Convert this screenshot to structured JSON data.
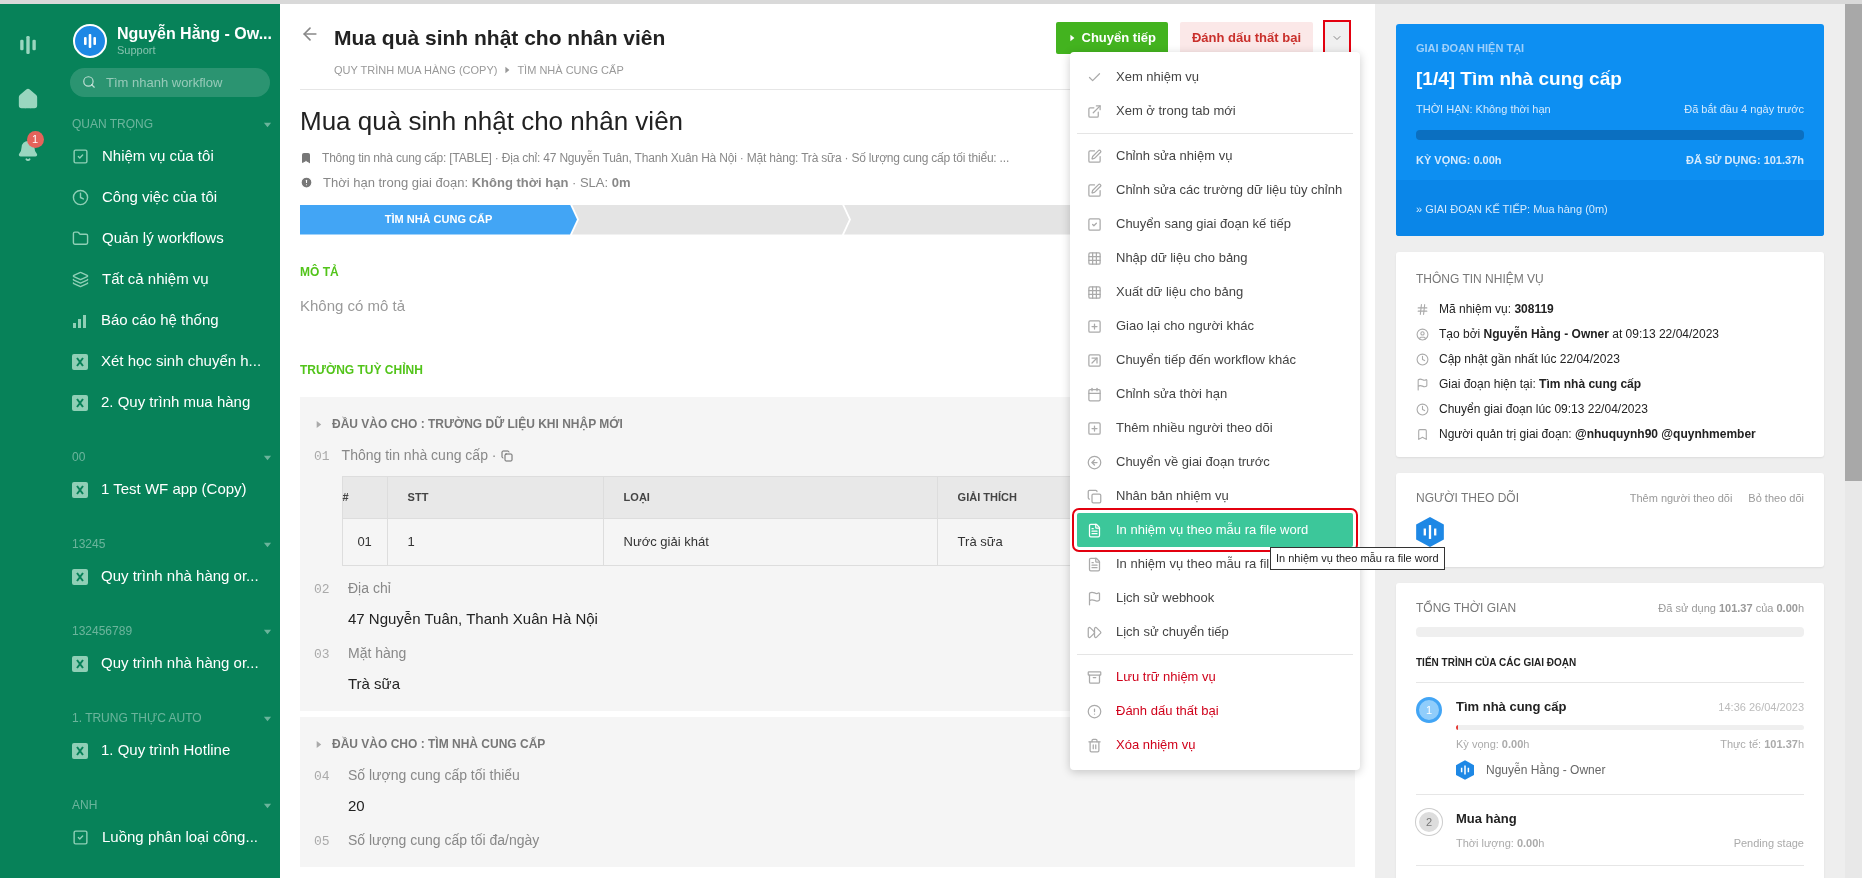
{
  "rail": {
    "notification_count": "1"
  },
  "user": {
    "name": "Nguyễn Hằng - Ow...",
    "role": "Support"
  },
  "search": {
    "placeholder": "Tìm nhanh workflow"
  },
  "sidebar_sections": [
    {
      "title": "QUAN TRỌNG",
      "items": [
        {
          "label": "Nhiệm vụ của tôi",
          "kind": "shortcut"
        },
        {
          "label": "Công việc của tôi",
          "kind": "shortcut"
        },
        {
          "label": "Quản lý workflows",
          "kind": "shortcut"
        },
        {
          "label": "Tất cả nhiệm vụ",
          "kind": "shortcut"
        },
        {
          "label": "Báo cáo hệ thống",
          "kind": "shortcut"
        },
        {
          "label": "Xét học sinh chuyển h...",
          "kind": "workflow"
        },
        {
          "label": "2. Quy trình mua hàng",
          "kind": "workflow"
        }
      ]
    },
    {
      "title": "00",
      "items": [
        {
          "label": "1 Test WF app (Copy)",
          "kind": "workflow"
        }
      ]
    },
    {
      "title": "13245",
      "items": [
        {
          "label": "Quy trình nhà hàng or...",
          "kind": "workflow"
        }
      ]
    },
    {
      "title": "132456789",
      "items": [
        {
          "label": "Quy trình nhà hàng or...",
          "kind": "workflow"
        }
      ]
    },
    {
      "title": "1. TRUNG THỰC AUTO",
      "items": [
        {
          "label": "1. Quy trình Hotline",
          "kind": "workflow"
        }
      ]
    },
    {
      "title": "ANH",
      "items": [
        {
          "label": "Luồng phân loại công...",
          "kind": "task"
        }
      ]
    }
  ],
  "header": {
    "title": "Mua quà sinh nhật cho nhân viên",
    "breadcrumb": [
      "QUY TRÌNH MUA HÀNG (COPY)",
      "TÌM NHÀ CUNG CẤP"
    ],
    "forward_button": "Chuyển tiếp",
    "fail_button": "Đánh dấu thất bại",
    "dropdown": {
      "expanded": true
    }
  },
  "task": {
    "title": "Mua quà sinh nhật cho nhân viên",
    "summary": "Thông tin nhà cung cấp: [TABLE] · Địa chỉ: 47 Nguyễn Tuân, Thanh Xuân Hà Nội · Mặt hàng: Trà sữa · Số lượng cung cấp tối thiểu: ...",
    "deadline": "Thời hạn trong giai đoạn: **Không thời hạn** · SLA: **0m**"
  },
  "stage_bar": {
    "stages": [
      {
        "label": "TÌM NHÀ CUNG CẤP",
        "selected": true
      },
      {
        "selected": false
      },
      {
        "selected": false
      }
    ]
  },
  "description": {
    "heading": "MÔ TẢ",
    "text": "Không có mô tả"
  },
  "custom_fields": {
    "heading": "TRƯỜNG TUỲ CHỈNH",
    "groups": [
      {
        "title": "ĐẦU VÀO CHO : TRƯỜNG DỮ LIỆU KHI NHẬP MỚI",
        "fields": [
          {
            "number": "01",
            "label": "Thông tin nhà cung cấp ·",
            "kind": "table",
            "table": {
              "columns": [
                "#",
                "STT",
                "LOẠI",
                "GIẢI THÍCH"
              ],
              "rows": [
                [
                  "01",
                  "1",
                  "Nước giải khát",
                  "Trà sữa"
                ]
              ]
            }
          },
          {
            "number": "02",
            "label": "Địa chỉ",
            "kind": "text",
            "value": "47 Nguyễn Tuân, Thanh Xuân Hà Nội"
          },
          {
            "number": "03",
            "label": "Mặt hàng",
            "kind": "text",
            "value": "Trà sữa"
          }
        ]
      },
      {
        "title": "ĐẦU VÀO CHO : TÌM NHÀ CUNG CẤP",
        "fields": [
          {
            "number": "04",
            "label": "Số lượng cung cấp tối thiểu",
            "kind": "text",
            "value": "20"
          },
          {
            "number": "05",
            "label": "Số lượng cung cấp tối đa/ngày",
            "kind": "text"
          }
        ]
      }
    ]
  },
  "menu": {
    "groups": [
      {
        "items": [
          {
            "label": "Xem nhiệm vụ",
            "danger": false,
            "selected": false
          },
          {
            "label": "Xem ở trong tab mới",
            "danger": false,
            "selected": false
          }
        ]
      },
      {
        "items": [
          {
            "label": "Chỉnh sửa nhiệm vụ",
            "danger": false,
            "selected": false
          },
          {
            "label": "Chỉnh sửa các trường dữ liệu tùy chỉnh",
            "danger": false,
            "selected": false
          },
          {
            "label": "Chuyển sang giai đoạn kế tiếp",
            "danger": false,
            "selected": false
          },
          {
            "label": "Nhập dữ liệu cho bảng",
            "danger": false,
            "selected": false
          },
          {
            "label": "Xuất dữ liệu cho bảng",
            "danger": false,
            "selected": false
          },
          {
            "label": "Giao lại cho người khác",
            "danger": false,
            "selected": false
          },
          {
            "label": "Chuyển tiếp đến workflow khác",
            "danger": false,
            "selected": false
          },
          {
            "label": "Chỉnh sửa thời hạn",
            "danger": false,
            "selected": false
          },
          {
            "label": "Thêm nhiều người theo dõi",
            "danger": false,
            "selected": false
          },
          {
            "label": "Chuyển về giai đoạn trước",
            "danger": false,
            "selected": false
          },
          {
            "label": "Nhân bản nhiệm vụ",
            "danger": false,
            "selected": false
          },
          {
            "label": "In nhiệm vụ theo mẫu ra file word",
            "danger": false,
            "selected": true
          },
          {
            "label": "In nhiệm vụ theo mẫu ra fil",
            "danger": false,
            "selected": false
          },
          {
            "label": "Lịch sử webhook",
            "danger": false,
            "selected": false
          },
          {
            "label": "Lịch sử chuyển tiếp",
            "danger": false,
            "selected": false
          }
        ]
      },
      {
        "items": [
          {
            "label": "Lưu trữ nhiệm vụ",
            "danger": true,
            "selected": false
          },
          {
            "label": "Đánh dấu thất bại",
            "danger": true,
            "selected": false
          },
          {
            "label": "Xóa nhiệm vụ",
            "danger": true,
            "selected": false
          }
        ]
      }
    ]
  },
  "tooltip": "In nhiệm vụ theo mẫu ra file word",
  "current_stage": {
    "label": "GIAI ĐOẠN HIỆN TẠI",
    "title": "[1/4] Tìm nhà cung cấp",
    "deadline": "THỜI HẠN: Không thời hạn",
    "started": "Đã bắt đầu 4 ngày trước",
    "level": 1,
    "expected": "KỲ VỌNG: 0.00h",
    "used": "ĐÃ SỬ DỤNG: **101.37h**",
    "next": "» GIAI ĐOẠN KẾ TIẾP: Mua hàng (0m)"
  },
  "task_info": {
    "title": "THÔNG TIN NHIỆM VỤ",
    "rows": [
      "Mã nhiệm vụ: **308119**",
      "Tạo bởi **Nguyễn Hằng - Owner** at 09:13 22/04/2023",
      "Cập nhật gần nhất lúc 22/04/2023",
      "Giai đoạn hiện tại: **Tìm nhà cung cấp**",
      "Chuyển giai đoạn lúc 09:13 22/04/2023",
      "Người quản trị giai đoạn: **@nhuquynh90 @quynhmember**"
    ]
  },
  "followers": {
    "title": "NGƯỜI THEO DÕI",
    "add": "Thêm người theo dõi",
    "unfollow": "Bỏ theo dõi"
  },
  "total_time": {
    "title": "TỔNG THỜI GIAN",
    "summary": "Đã sử dụng **101.37** của **0.00**h",
    "level": 0,
    "progress_heading": "TIẾN TRÌNH CỦA CÁC GIAI ĐOẠN",
    "stages": [
      {
        "number": "1",
        "name": "Tìm nhà cung cấp",
        "time": "14:36 26/04/2023",
        "level": 0.005,
        "expected": "Kỳ vọng: **0.00**h",
        "actual": "Thực tế: **101.37**h",
        "assignee": "Nguyễn Hằng - Owner",
        "active": true
      },
      {
        "number": "2",
        "name": "Mua hàng",
        "duration": "Thời lượng: **0.00**h",
        "status": "Pending stage",
        "active": false
      }
    ]
  }
}
